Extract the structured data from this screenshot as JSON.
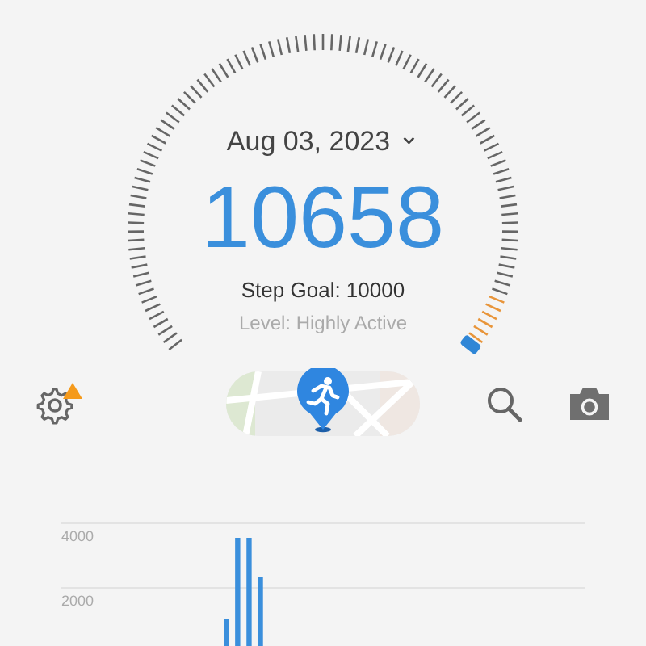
{
  "date": {
    "label": "Aug 03, 2023",
    "caret": "⌄"
  },
  "steps": "10658",
  "goal": "Step Goal: 10000",
  "level_text": "Level: Highly Active",
  "chart": {
    "chart_data": {
      "type": "bar",
      "ylim": [
        0,
        4000
      ],
      "yticks": [
        {
          "value": 2000,
          "label": "2000"
        },
        {
          "value": 4000,
          "label": "4000"
        }
      ],
      "categories": [
        null,
        null,
        null,
        null,
        null,
        null,
        null,
        null,
        null,
        null,
        null,
        null,
        null,
        null,
        null,
        null,
        null,
        null,
        null,
        null,
        null,
        null,
        null,
        null,
        null,
        null,
        null,
        null,
        null,
        null,
        null,
        null,
        null,
        null,
        null,
        null,
        null,
        null,
        null,
        null,
        null,
        null,
        null,
        null,
        null,
        null
      ],
      "series": [
        {
          "color": "#3a8fdc",
          "values": [
            0,
            0,
            0,
            0,
            0,
            0,
            0,
            0,
            0,
            0,
            0,
            0,
            0,
            0,
            1050,
            3550,
            3550,
            2350,
            0,
            0,
            0,
            0,
            0,
            0,
            0,
            0,
            0,
            0,
            0,
            0,
            0,
            0,
            0,
            0,
            0,
            0,
            0,
            0,
            0,
            0,
            0,
            0,
            0,
            0,
            0,
            0
          ]
        }
      ]
    }
  }
}
